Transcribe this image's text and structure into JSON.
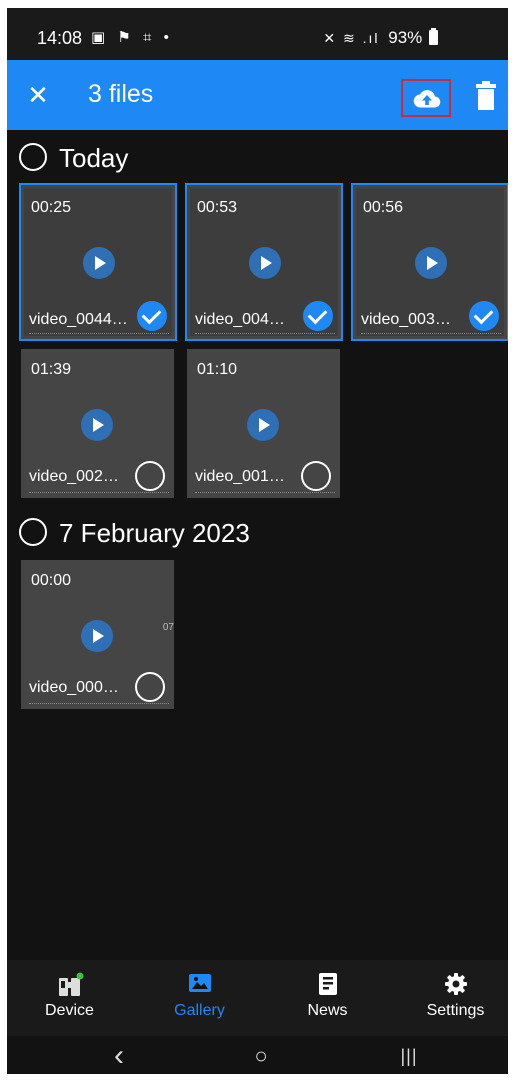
{
  "status_bar": {
    "time": "14:08",
    "left_icons": "▣ ⚑ ⌗ •",
    "signal": "✕ ≋ .ıl",
    "battery": "93%"
  },
  "app_bar": {
    "close_symbol": "✕",
    "title": "3 files",
    "upload_icon": "cloud-upload-icon",
    "delete_icon": "trash-icon",
    "accent_color": "#1e88f5"
  },
  "sections": [
    {
      "title": "Today",
      "items": [
        {
          "duration": "00:25",
          "name": "video_0044…",
          "selected": true
        },
        {
          "duration": "00:53",
          "name": "video_004…",
          "selected": true
        },
        {
          "duration": "00:56",
          "name": "video_003…",
          "selected": true
        },
        {
          "duration": "01:39",
          "name": "video_002…",
          "selected": false
        },
        {
          "duration": "01:10",
          "name": "video_001…",
          "selected": false
        }
      ]
    },
    {
      "title": "7 February 2023",
      "items": [
        {
          "duration": "00:00",
          "name": "video_000…",
          "selected": false,
          "edge_text": "07"
        }
      ]
    }
  ],
  "bottom_nav": {
    "items": [
      {
        "label": "Device",
        "icon": "binoculars-icon",
        "active": false
      },
      {
        "label": "Gallery",
        "icon": "image-icon",
        "active": true
      },
      {
        "label": "News",
        "icon": "news-icon",
        "active": false
      },
      {
        "label": "Settings",
        "icon": "gear-icon",
        "active": false
      }
    ]
  },
  "system_nav": {
    "back": "‹",
    "home": "○",
    "recents": "|||"
  }
}
